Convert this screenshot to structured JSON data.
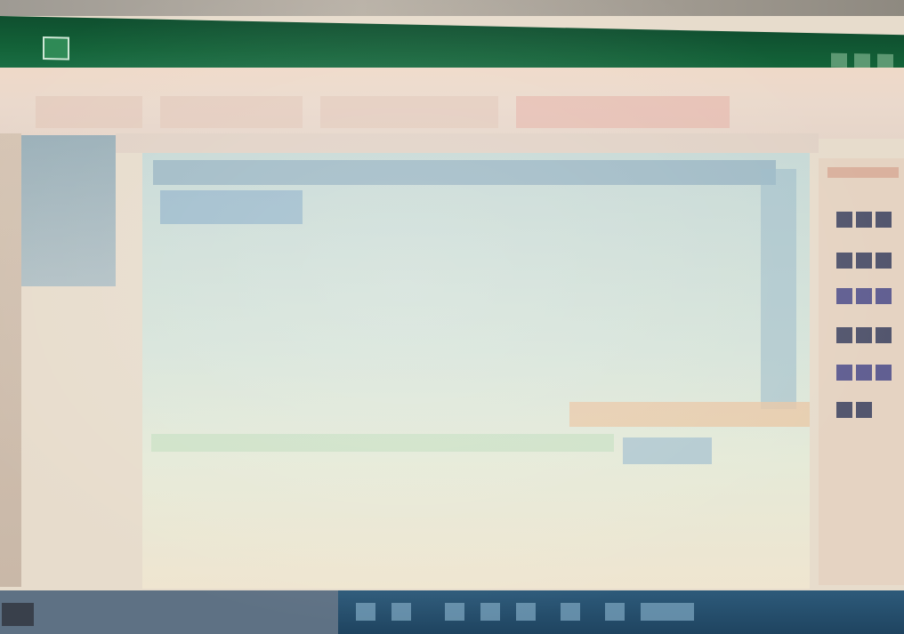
{
  "window": {
    "app_icon": "spreadsheet-app-icon",
    "title": "",
    "controls": [
      "minimize-icon",
      "maximize-icon",
      "close-icon"
    ]
  },
  "ribbon": {
    "tabs": []
  },
  "nav_pane": {
    "items": []
  },
  "sheet": {
    "title": "",
    "rows": []
  },
  "right_panel": {
    "items": 6
  },
  "taskbar": {
    "start_icon": "start-icon",
    "icons": [
      "taskbar-app-icon",
      "taskbar-app-icon",
      "taskbar-app-icon",
      "taskbar-app-icon",
      "taskbar-app-icon",
      "taskbar-app-icon",
      "taskbar-app-icon",
      "taskbar-app-icon"
    ]
  },
  "colors": {
    "titlebar": "#136238",
    "sheet_header": "#97b3c2",
    "taskbar": "#1f4460"
  }
}
